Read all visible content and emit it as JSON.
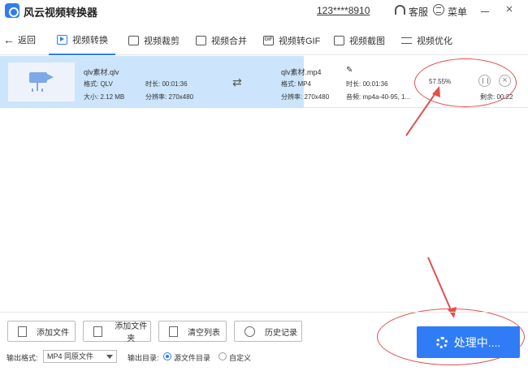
{
  "app": {
    "title": "风云视频转换器",
    "account": "123****8910",
    "customer_service": "客服",
    "menu": "菜单",
    "close_glyph": "×"
  },
  "nav": {
    "back_label": "返回",
    "tabs": [
      {
        "label": "视频转换",
        "icon": "video-convert-icon",
        "active": true
      },
      {
        "label": "视频裁剪",
        "icon": "video-crop-icon",
        "active": false
      },
      {
        "label": "视频合并",
        "icon": "video-merge-icon",
        "active": false
      },
      {
        "label": "视频转GIF",
        "icon": "gif-icon",
        "active": false
      },
      {
        "label": "视频截图",
        "icon": "screenshot-icon",
        "active": false
      },
      {
        "label": "视频优化",
        "icon": "sliders-icon",
        "active": false
      }
    ]
  },
  "file": {
    "source": {
      "name": "qlv素材.qlv",
      "format": "格式: QLV",
      "duration": "时长: 00:01:36",
      "size": "大小: 2.12 MB",
      "resolution": "分辨率: 270x480"
    },
    "output": {
      "name": "qlv素材.mp4",
      "format": "格式: MP4",
      "duration": "时长: 00:01:36",
      "resolution": "分辨率: 270x480",
      "audio": "音频: mp4a-40-95, 1..."
    },
    "progress": {
      "percent_text": "57.55%",
      "percent": 57.55,
      "remaining": "剩余: 00:22"
    }
  },
  "toolbar": {
    "add_file": "添加文件",
    "add_folder": "添加文件夹",
    "clear_list": "清空列表",
    "history": "历史记录"
  },
  "output_settings": {
    "format_label": "输出格式:",
    "format_value": "MP4 同原文件",
    "dir_label": "输出目录:",
    "dir_options": [
      {
        "label": "源文件目录",
        "checked": true
      },
      {
        "label": "自定义",
        "checked": false
      }
    ]
  },
  "process_button": "处理中....",
  "colors": {
    "accent": "#2f7cf6",
    "row_highlight": "#cce5fc",
    "annotation": "#e05050"
  }
}
